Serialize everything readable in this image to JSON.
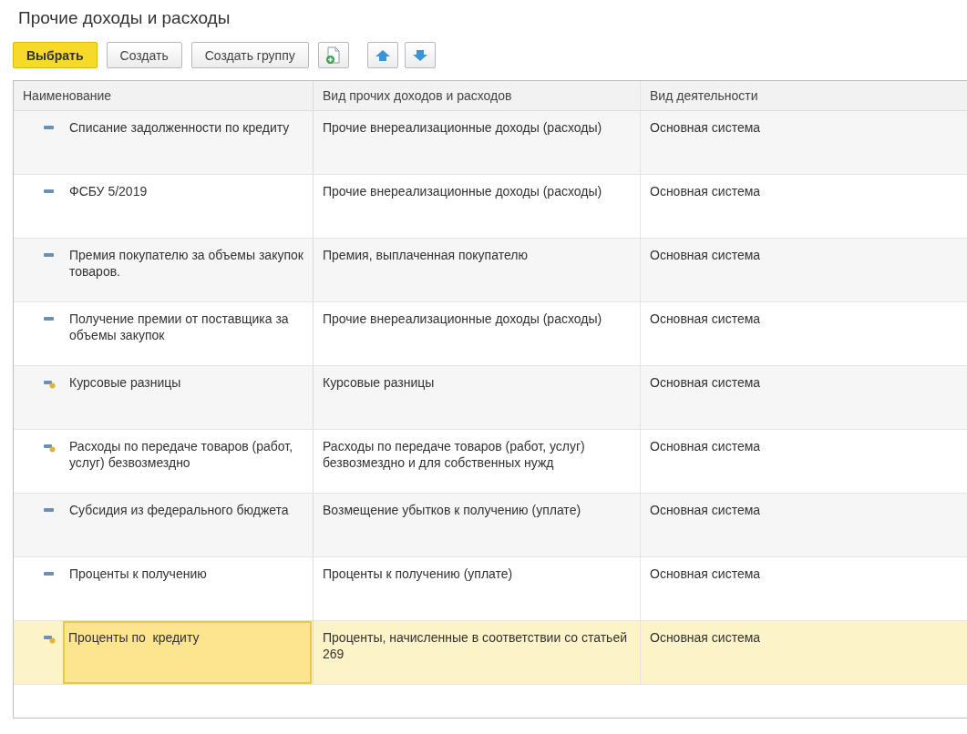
{
  "title": "Прочие доходы и расходы",
  "toolbar": {
    "buttons": [
      {
        "label": "Выбрать",
        "kind": "default"
      },
      {
        "label": "Создать",
        "kind": "plain"
      },
      {
        "label": "Создать группу",
        "kind": "plain"
      }
    ],
    "icon_buttons": [
      {
        "kind": "add-copy"
      },
      {
        "kind": "up"
      },
      {
        "kind": "down"
      }
    ]
  },
  "table": {
    "columns": [
      "Наименование",
      "Вид прочих доходов и расходов",
      "Вид деятельности"
    ],
    "rows": [
      {
        "kind": "item",
        "name": "Списание задолженности по кредиту",
        "type": "Прочие внереализационные доходы (расходы)",
        "activity": "Основная система",
        "selected": false
      },
      {
        "kind": "item",
        "name": "ФСБУ 5/2019",
        "type": "Прочие внереализационные доходы (расходы)",
        "activity": "Основная система",
        "selected": false
      },
      {
        "kind": "item",
        "name": "Премия покупателю за объемы закупок товаров.",
        "type": "Премия, выплаченная покупателю",
        "activity": "Основная система",
        "selected": false
      },
      {
        "kind": "item",
        "name": "Получение премии от поставщика за объемы закупок",
        "type": "Прочие внереализационные доходы (расходы)",
        "activity": "Основная система",
        "selected": false
      },
      {
        "kind": "predefined",
        "name": "Курсовые разницы",
        "type": "Курсовые разницы",
        "activity": "Основная система",
        "selected": false
      },
      {
        "kind": "predefined",
        "name": "Расходы по передаче товаров (работ, услуг) безвозмездно",
        "type": "Расходы по передаче товаров (работ, услуг) безвозмездно и для собственных нужд",
        "activity": "Основная система",
        "selected": false
      },
      {
        "kind": "item",
        "name": "Субсидия из федерального бюджета",
        "type": "Возмещение убытков к получению (уплате)",
        "activity": "Основная система",
        "selected": false
      },
      {
        "kind": "item",
        "name": "Проценты к получению",
        "type": "Проценты к получению (уплате)",
        "activity": "Основная система",
        "selected": false
      },
      {
        "kind": "predefined",
        "name": "Проценты по  кредиту",
        "type": "Проценты, начисленные в соответствии со статьей 269",
        "activity": "Основная система",
        "selected": true
      }
    ]
  }
}
